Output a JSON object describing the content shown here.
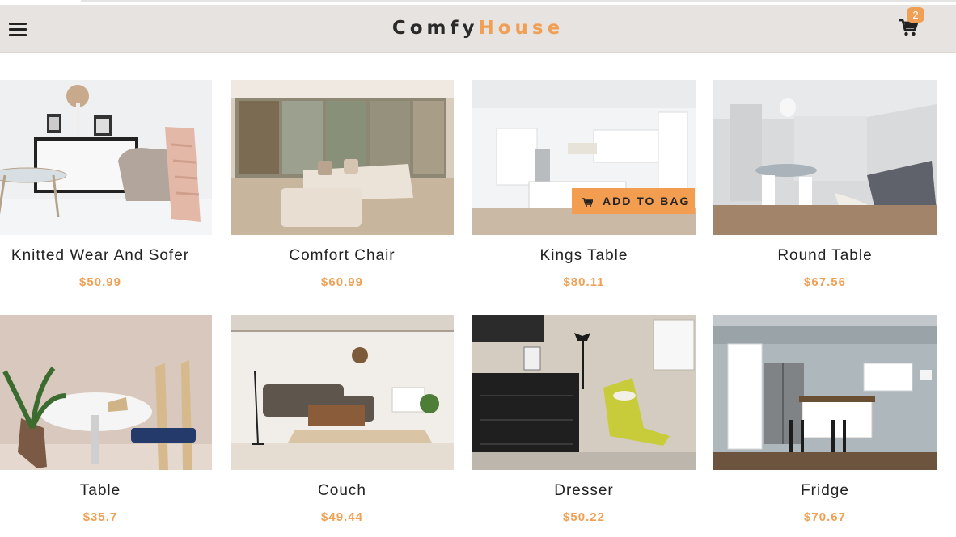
{
  "header": {
    "logo_part1": "Comfy",
    "logo_part2": "House",
    "cart_count": "2"
  },
  "products": [
    {
      "name": "Knitted Wear And Sofer",
      "price": "$50.99"
    },
    {
      "name": "Comfort Chair",
      "price": "$60.99"
    },
    {
      "name": "Kings Table",
      "price": "$80.11",
      "button": "ADD TO BAG"
    },
    {
      "name": "Round Table",
      "price": "$67.56"
    },
    {
      "name": "Table",
      "price": "$35.7"
    },
    {
      "name": "Couch",
      "price": "$49.44"
    },
    {
      "name": "Dresser",
      "price": "$50.22"
    },
    {
      "name": "Fridge",
      "price": "$70.67"
    }
  ],
  "icons": {
    "menu": "hamburger-menu-icon",
    "cart": "shopping-cart-icon"
  },
  "colors": {
    "accent": "#f0a055",
    "navbar": "#e7e3e0",
    "text": "#222222"
  }
}
